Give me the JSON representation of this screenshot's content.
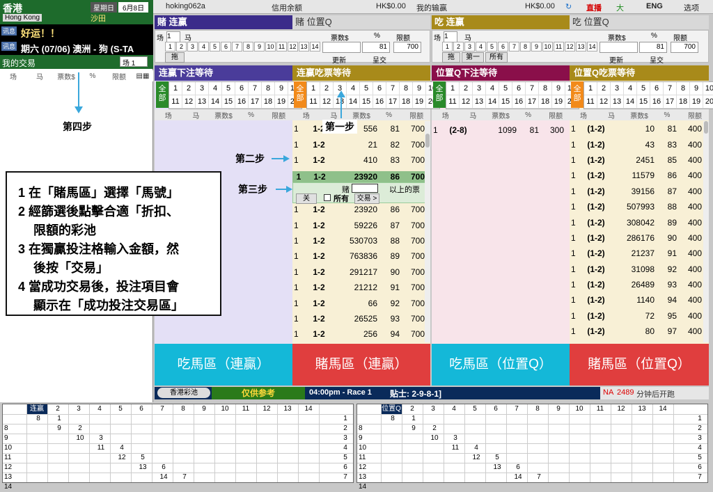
{
  "left": {
    "city": "香港",
    "city_en": "Hong Kong",
    "weekday": "星期日",
    "date": "6月8日",
    "venue": "沙田",
    "msg1_tag": "讯息",
    "msg1": "好运！！",
    "msg2_tag": "讯息",
    "msg2": "期六 (07/06) 澳洲 - 狗 (S-TA",
    "my_trades": "我的交易",
    "race_select": "场 1",
    "cols": [
      "场",
      "马",
      "票数$",
      "%",
      "限额"
    ],
    "step4": "第四步"
  },
  "topbar": {
    "user": "hoking062a",
    "credit_label": "信用余额",
    "credit": "HK$0.00",
    "pnl_label": "我的输赢",
    "pnl": "HK$0.00",
    "live": "直播",
    "font": "大",
    "lang": "ENG",
    "options": "选项"
  },
  "panels": {
    "bet_win": {
      "tab": "赌 连赢",
      "title": "连赢下注等待"
    },
    "bet_place": {
      "tab": "赌 位置Q"
    },
    "eat_win": {
      "tab": "吃 连赢",
      "title": "连赢吃票等待"
    },
    "eat_place": {
      "tab": "吃 位置Q",
      "title": "位置Q下注等待"
    },
    "eat_place_wait": {
      "title": "位置Q吃票等待"
    }
  },
  "form": {
    "race_label": "场",
    "race": "1",
    "horse_label": "马",
    "tickets_label": "票数$",
    "pct_label": "%",
    "limit_label": "限额",
    "pct": "81",
    "limit": "700",
    "drag": "拖",
    "first": "第一",
    "all": "所有",
    "update": "更新",
    "submit": "呈交",
    "nums": [
      "1",
      "2",
      "3",
      "4",
      "5",
      "6",
      "7",
      "8",
      "9",
      "10",
      "11",
      "12",
      "13",
      "14"
    ]
  },
  "grid_nums": [
    "1",
    "2",
    "3",
    "4",
    "5",
    "6",
    "7",
    "8",
    "9",
    "10",
    "11",
    "12",
    "13",
    "14",
    "15",
    "16",
    "17",
    "18",
    "19",
    "20"
  ],
  "all_label": "全部",
  "list_cols": [
    "场",
    "马",
    "票数$",
    "%",
    "限额"
  ],
  "bet_rows": [
    [
      "1",
      "1-2",
      "556",
      "81",
      "700"
    ],
    [
      "1",
      "1-2",
      "21",
      "82",
      "700"
    ],
    [
      "1",
      "1-2",
      "410",
      "83",
      "700"
    ]
  ],
  "selected_row": [
    "1",
    "1-2",
    "23920",
    "86",
    "700"
  ],
  "trade_popup": {
    "bet": "赌",
    "above": "以上的票",
    "close": "关",
    "all": "所有",
    "trade": "交易 >"
  },
  "bet_rows2": [
    [
      "1",
      "1-2",
      "23920",
      "86",
      "700"
    ],
    [
      "1",
      "1-2",
      "59226",
      "87",
      "700"
    ],
    [
      "1",
      "1-2",
      "530703",
      "88",
      "700"
    ],
    [
      "1",
      "1-2",
      "763836",
      "89",
      "700"
    ],
    [
      "1",
      "1-2",
      "291217",
      "90",
      "700"
    ],
    [
      "1",
      "1-2",
      "21212",
      "91",
      "700"
    ],
    [
      "1",
      "1-2",
      "66",
      "92",
      "700"
    ],
    [
      "1",
      "1-2",
      "26525",
      "93",
      "700"
    ],
    [
      "1",
      "1-2",
      "256",
      "94",
      "700"
    ]
  ],
  "place_bet_rows": [
    [
      "1",
      "(2-8)",
      "1099",
      "81",
      "300"
    ]
  ],
  "place_eat_rows": [
    [
      "1",
      "(1-2)",
      "10",
      "81",
      "400"
    ],
    [
      "1",
      "(1-2)",
      "43",
      "83",
      "400"
    ],
    [
      "1",
      "(1-2)",
      "2451",
      "85",
      "400"
    ],
    [
      "1",
      "(1-2)",
      "11579",
      "86",
      "400"
    ],
    [
      "1",
      "(1-2)",
      "39156",
      "87",
      "400"
    ],
    [
      "1",
      "(1-2)",
      "507993",
      "88",
      "400"
    ],
    [
      "1",
      "(1-2)",
      "308042",
      "89",
      "400"
    ],
    [
      "1",
      "(1-2)",
      "286176",
      "90",
      "400"
    ],
    [
      "1",
      "(1-2)",
      "21237",
      "91",
      "400"
    ],
    [
      "1",
      "(1-2)",
      "31098",
      "92",
      "400"
    ],
    [
      "1",
      "(1-2)",
      "26489",
      "93",
      "400"
    ],
    [
      "1",
      "(1-2)",
      "1140",
      "94",
      "400"
    ],
    [
      "1",
      "(1-2)",
      "72",
      "95",
      "400"
    ],
    [
      "1",
      "(1-2)",
      "80",
      "97",
      "400"
    ]
  ],
  "big_buttons": [
    "吃馬區（連贏）",
    "賭馬區（連贏）",
    "吃馬區（位置Q）",
    "賭馬區（位置Q）"
  ],
  "steps": {
    "s1": "第一步",
    "s2": "第二步",
    "s3": "第三步"
  },
  "instructions": [
    "1 在「賭馬區」選擇「馬號」",
    "2 經篩選後點擊合適「折扣、",
    "   限額的彩池",
    "3 在獨贏投注格輸入金額，然",
    "   後按「交易」",
    "4 當成功交易後，投注項目會",
    "   顯示在「成功投注交易區」"
  ],
  "statusbar": {
    "hkjc": "香港彩池",
    "ref": "仅供参考",
    "race": "04:00pm - Race 1",
    "tips": "贴士: 2-9-8-1]",
    "na": "NA",
    "count": "2489",
    "start": "分钟后开跑"
  },
  "grid_left": {
    "title": "连赢",
    "cols": [
      "2",
      "3",
      "4",
      "5",
      "6",
      "7",
      "8",
      "9",
      "10",
      "11",
      "12",
      "13",
      "14"
    ],
    "rows": [
      "8",
      "9",
      "10",
      "11",
      "12",
      "13",
      "14"
    ],
    "right": [
      "1",
      "2",
      "3",
      "4",
      "5",
      "6",
      "7"
    ],
    "cells": [
      [
        "8",
        "1"
      ],
      [
        "9",
        "2"
      ],
      [
        "10",
        "3"
      ],
      [
        "11",
        "4"
      ],
      [
        "12",
        "5"
      ],
      [
        "13",
        "6"
      ],
      [
        "14",
        "7"
      ]
    ]
  },
  "grid_right": {
    "title": "位置Q",
    "cols": [
      "2",
      "3",
      "4",
      "5",
      "6",
      "7",
      "8",
      "9",
      "10",
      "11",
      "12",
      "13",
      "14"
    ],
    "rows": [
      "8",
      "9",
      "10",
      "11",
      "12",
      "13",
      "14"
    ],
    "right": [
      "1",
      "2",
      "3",
      "4",
      "5",
      "6",
      "7"
    ],
    "cells": [
      [
        "8",
        "1"
      ],
      [
        "9",
        "2"
      ],
      [
        "10",
        "3"
      ],
      [
        "11",
        "4"
      ],
      [
        "12",
        "5"
      ],
      [
        "13",
        "6"
      ],
      [
        "14",
        "7"
      ]
    ]
  }
}
